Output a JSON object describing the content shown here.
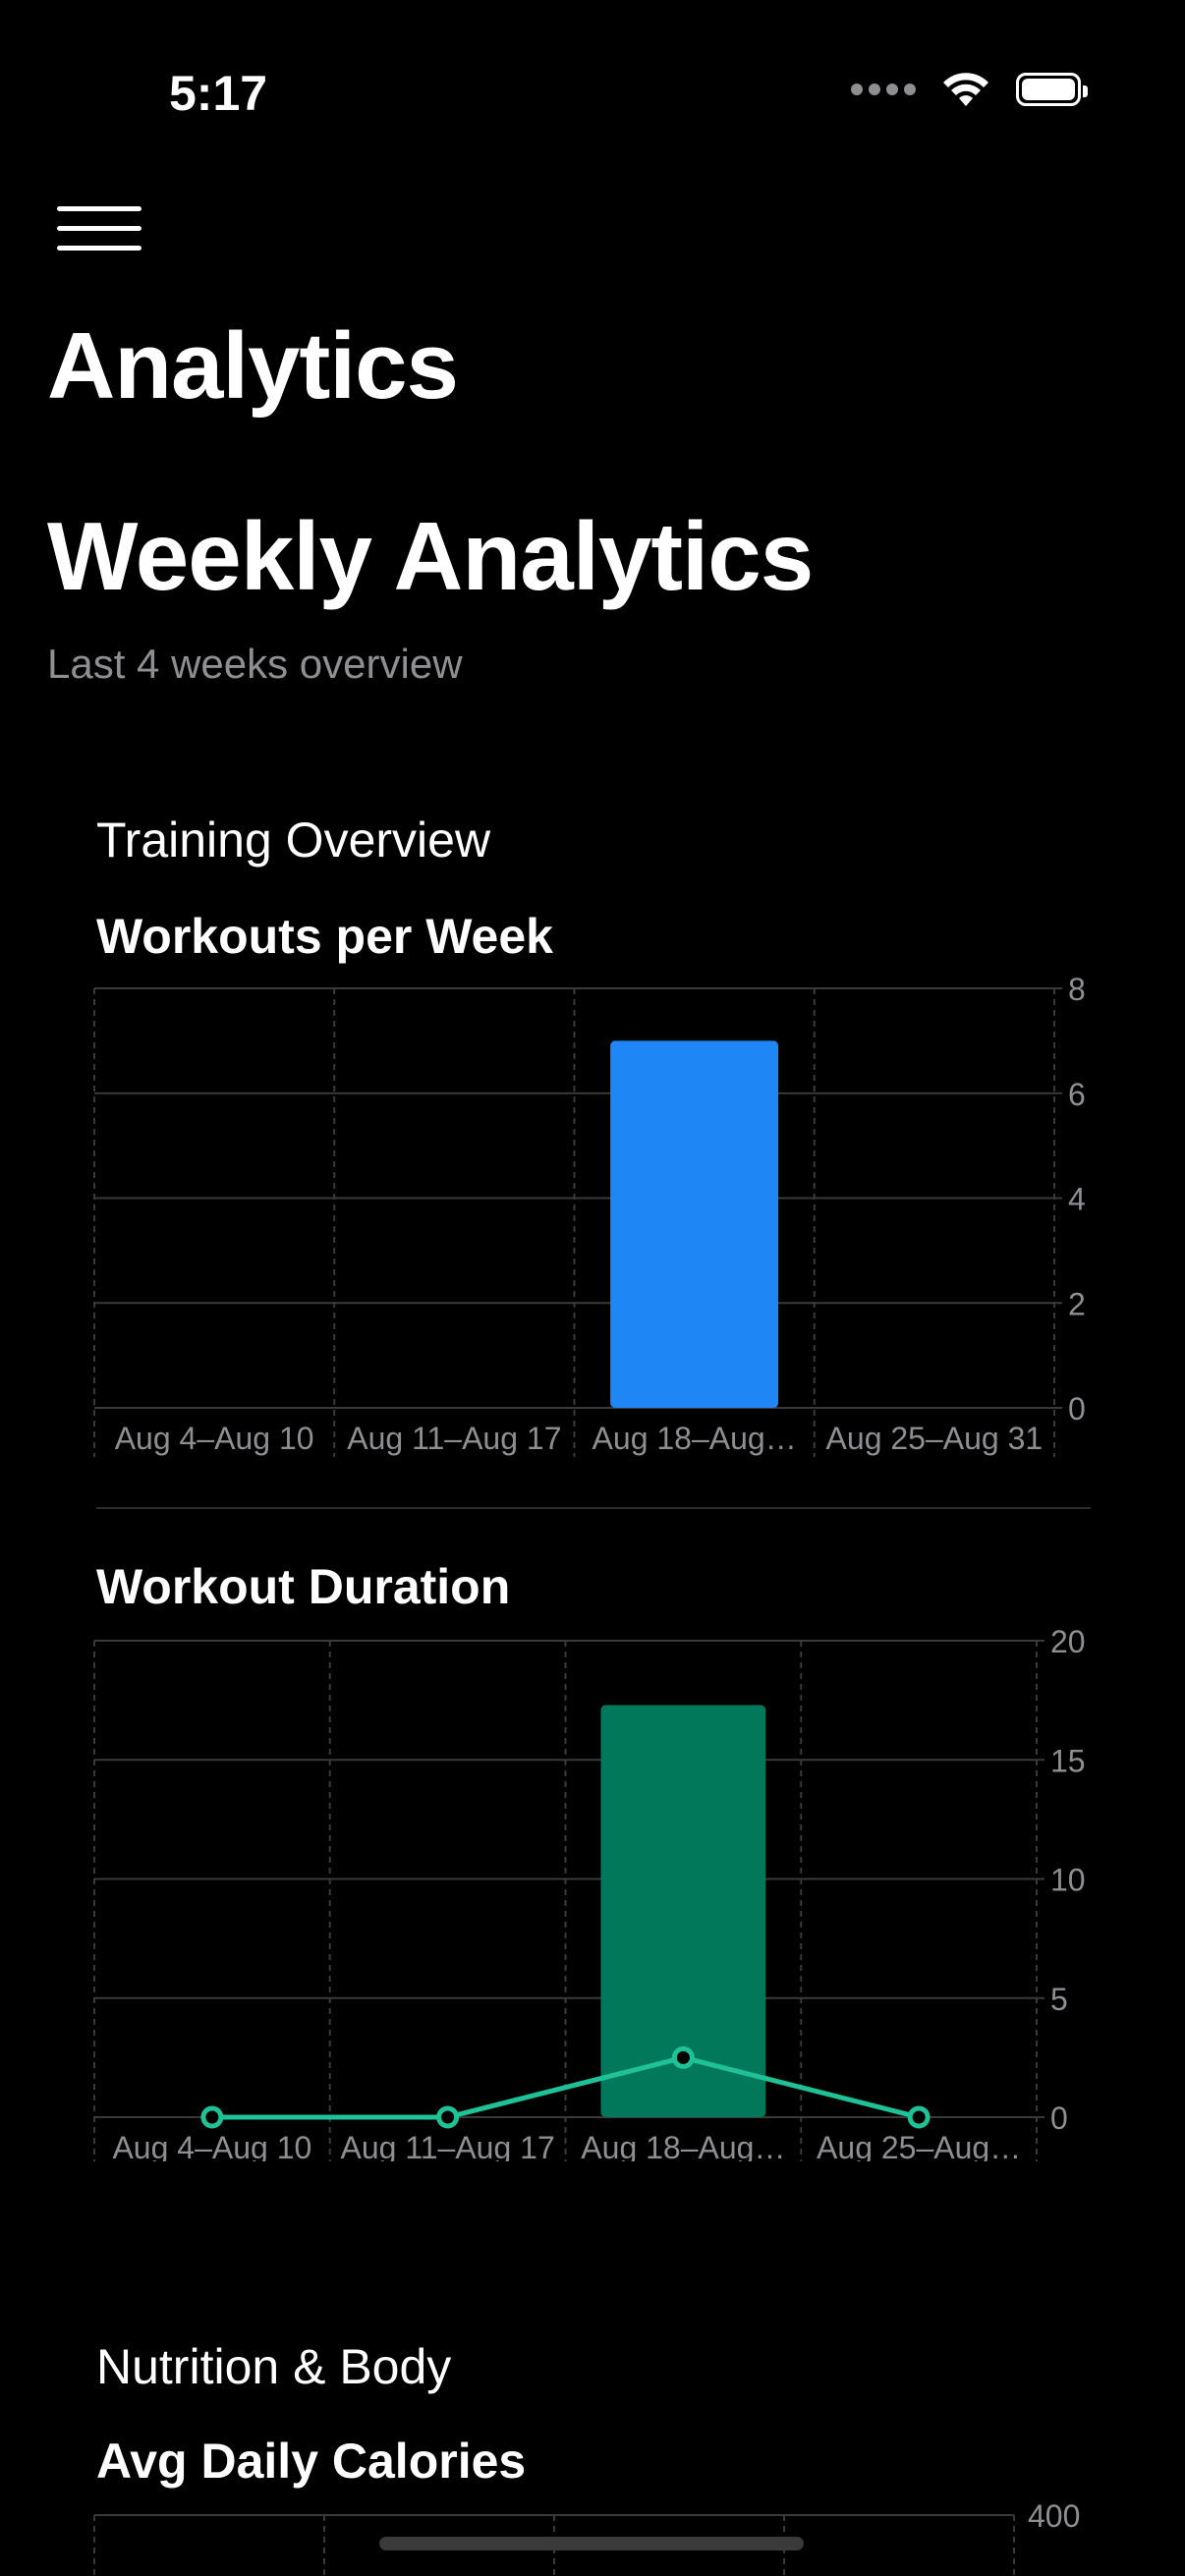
{
  "status_bar": {
    "time": "5:17"
  },
  "nav": {
    "title": "Analytics",
    "menu_icon": "hamburger-menu-icon"
  },
  "header": {
    "title": "Weekly Analytics",
    "subtitle": "Last 4 weeks overview"
  },
  "training": {
    "section_title": "Training Overview",
    "workouts_title": "Workouts per Week",
    "duration_title": "Workout Duration"
  },
  "nutrition": {
    "section_title": "Nutrition & Body",
    "calories_title": "Avg Daily Calories"
  },
  "colors": {
    "blue": "#1f87f5",
    "green": "#02785a",
    "green_line": "#1fc196"
  },
  "chart_data": [
    {
      "type": "bar",
      "title": "Workouts per Week",
      "categories": [
        "Aug 4–Aug 10",
        "Aug 11–Aug 17",
        "Aug 18–Aug…",
        "Aug 25–Aug 31"
      ],
      "values": [
        0,
        0,
        7,
        0
      ],
      "yticks": [
        "0",
        "2",
        "4",
        "6",
        "8"
      ],
      "ylim": [
        0,
        8
      ],
      "grid": true
    },
    {
      "type": "bar",
      "title": "Workout Duration",
      "categories": [
        "Aug 4–Aug 10",
        "Aug 11–Aug 17",
        "Aug 18–Aug…",
        "Aug 25–Aug…"
      ],
      "series": [
        {
          "type": "bar",
          "values": [
            0,
            0,
            17.3,
            0
          ]
        },
        {
          "type": "line",
          "values": [
            0,
            0,
            2.5,
            0
          ]
        }
      ],
      "yticks": [
        "0",
        "5",
        "10",
        "15",
        "20"
      ],
      "ylim": [
        0,
        20
      ],
      "grid": true
    },
    {
      "type": "bar",
      "title": "Avg Daily Calories",
      "yticks": [
        "400"
      ],
      "ylim": [
        0,
        400
      ],
      "grid": true
    }
  ]
}
